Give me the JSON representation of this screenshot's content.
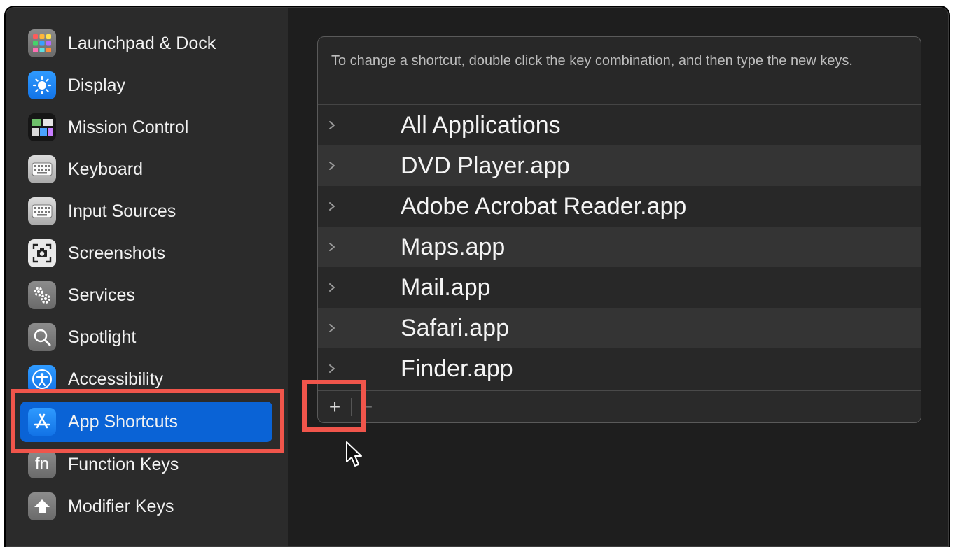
{
  "sidebar": {
    "items": [
      {
        "label": "Launchpad & Dock",
        "icon": "launchpad-icon"
      },
      {
        "label": "Display",
        "icon": "display-brightness-icon"
      },
      {
        "label": "Mission Control",
        "icon": "mission-control-icon"
      },
      {
        "label": "Keyboard",
        "icon": "keyboard-icon"
      },
      {
        "label": "Input Sources",
        "icon": "keyboard-icon"
      },
      {
        "label": "Screenshots",
        "icon": "camera-icon"
      },
      {
        "label": "Services",
        "icon": "gears-icon"
      },
      {
        "label": "Spotlight",
        "icon": "magnifier-icon"
      },
      {
        "label": "Accessibility",
        "icon": "accessibility-icon"
      },
      {
        "label": "App Shortcuts",
        "icon": "app-store-icon",
        "selected": true
      },
      {
        "label": "Function Keys",
        "icon": "fn-icon"
      },
      {
        "label": "Modifier Keys",
        "icon": "arrow-up-icon"
      }
    ],
    "fn_glyph": "fn"
  },
  "main": {
    "instructions": "To change a shortcut, double click the key combination, and then type the new keys.",
    "apps": [
      "All Applications",
      "DVD Player.app",
      "Adobe Acrobat Reader.app",
      "Maps.app",
      "Mail.app",
      "Safari.app",
      "Finder.app"
    ],
    "add_label": "+",
    "remove_label": "−"
  },
  "colors": {
    "selection": "#0a63d6",
    "annotation": "#f0554b"
  }
}
